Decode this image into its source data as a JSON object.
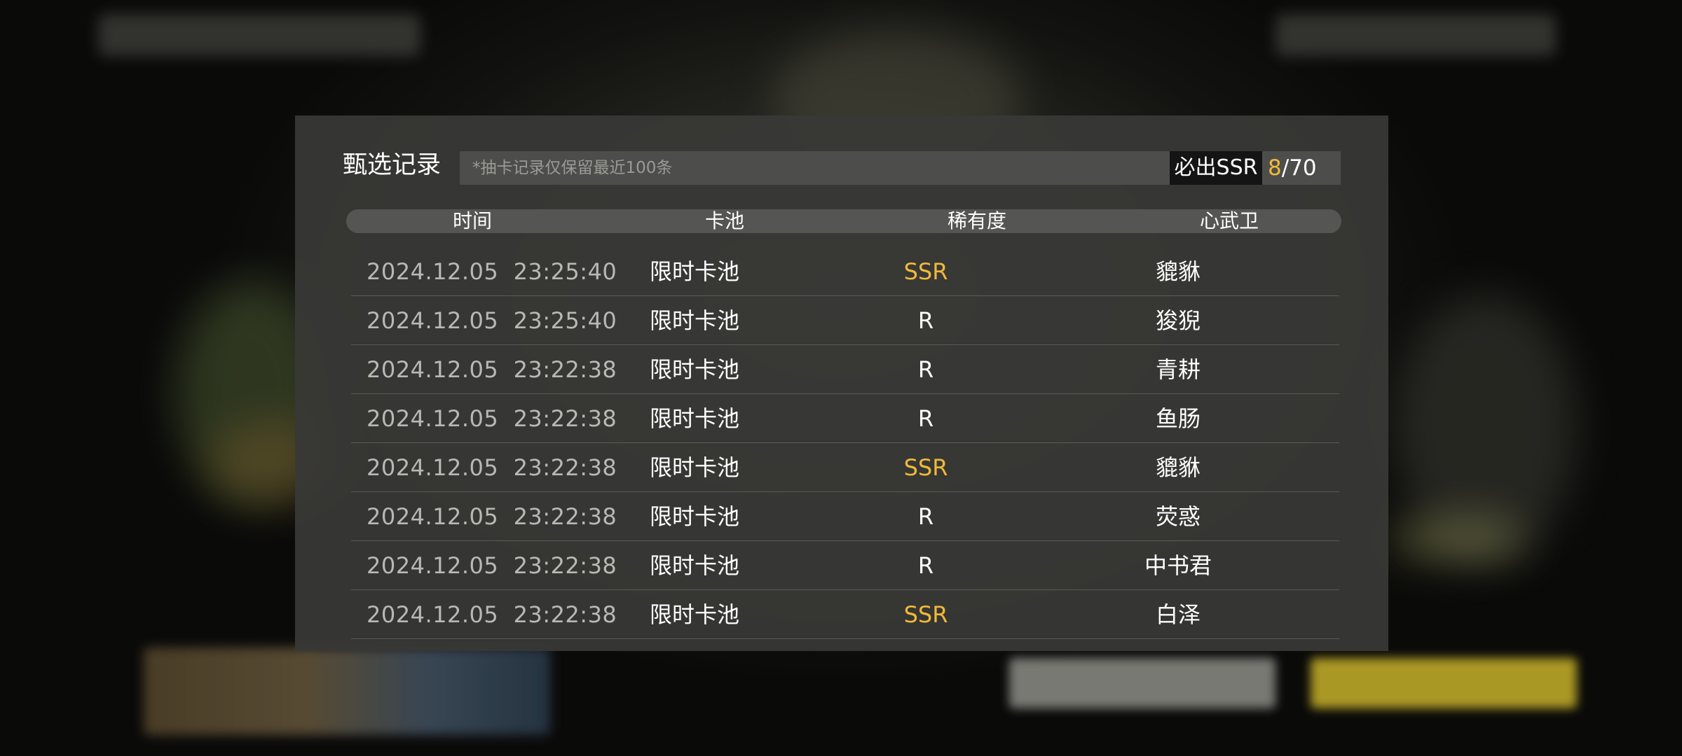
{
  "panel": {
    "title": "甄选记录",
    "notice": "*抽卡记录仅保留最近100条",
    "pity_label": "必出SSR",
    "pity_current": "8",
    "pity_separator": "/",
    "pity_total": "70"
  },
  "table": {
    "headers": {
      "time": "时间",
      "pool": "卡池",
      "rarity": "稀有度",
      "character": "心武卫"
    },
    "rows": [
      {
        "time": "2024.12.05  23:25:40",
        "pool": "限时卡池",
        "rarity": "SSR",
        "character": "貔貅"
      },
      {
        "time": "2024.12.05  23:25:40",
        "pool": "限时卡池",
        "rarity": "R",
        "character": "狻猊"
      },
      {
        "time": "2024.12.05  23:22:38",
        "pool": "限时卡池",
        "rarity": "R",
        "character": "青耕"
      },
      {
        "time": "2024.12.05  23:22:38",
        "pool": "限时卡池",
        "rarity": "R",
        "character": "鱼肠"
      },
      {
        "time": "2024.12.05  23:22:38",
        "pool": "限时卡池",
        "rarity": "SSR",
        "character": "貔貅"
      },
      {
        "time": "2024.12.05  23:22:38",
        "pool": "限时卡池",
        "rarity": "R",
        "character": "荧惑"
      },
      {
        "time": "2024.12.05  23:22:38",
        "pool": "限时卡池",
        "rarity": "R",
        "character": "中书君"
      },
      {
        "time": "2024.12.05  23:22:38",
        "pool": "限时卡池",
        "rarity": "SSR",
        "character": "白泽"
      }
    ]
  },
  "colors": {
    "ssr": "#f0b93a",
    "panel_bg": "#383836",
    "pity_label_bg": "#141414"
  }
}
